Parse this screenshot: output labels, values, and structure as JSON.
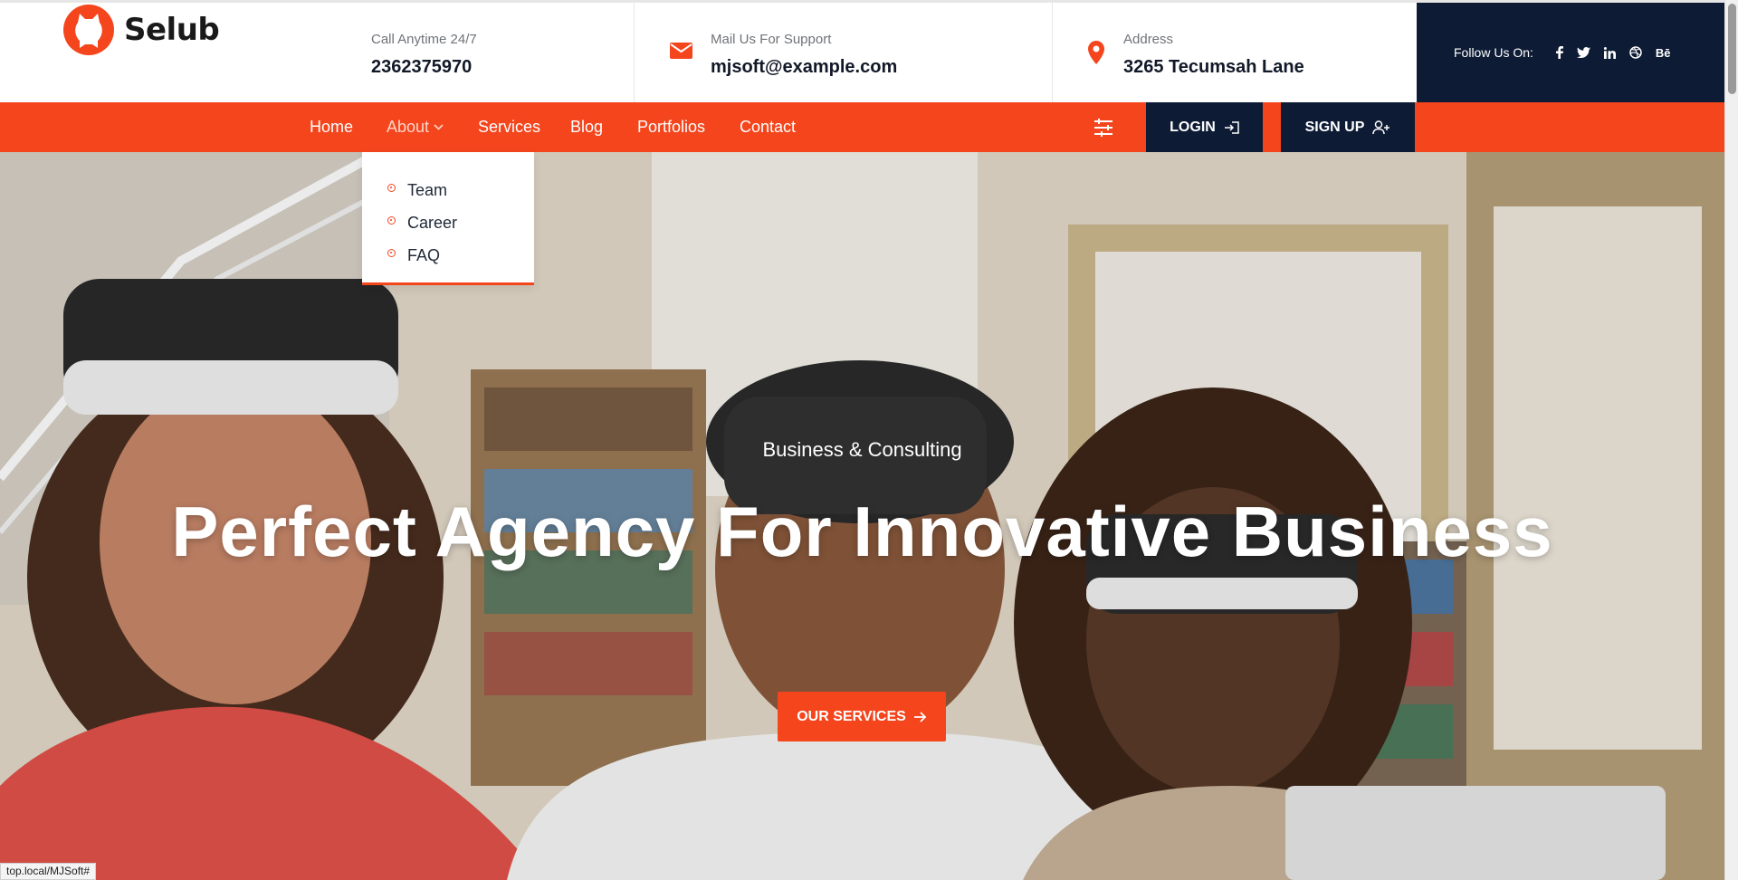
{
  "brand": {
    "name": "Selub",
    "accent": "#f4451d",
    "dark": "#0d1b35"
  },
  "contact": {
    "phone_label": "Call Anytime 24/7",
    "phone_value": "2362375970",
    "mail_label": "Mail Us For Support",
    "mail_value": "mjsoft@example.com",
    "address_label": "Address",
    "address_value": "3265 Tecumsah Lane"
  },
  "social": {
    "label": "Follow Us On:",
    "icons": [
      "facebook-icon",
      "twitter-icon",
      "linkedin-icon",
      "dribbble-icon",
      "behance-icon"
    ],
    "behance_text": "Bē"
  },
  "nav": {
    "items": [
      {
        "label": "Home"
      },
      {
        "label": "About",
        "active": true
      },
      {
        "label": "Services"
      },
      {
        "label": "Blog"
      },
      {
        "label": "Portfolios"
      },
      {
        "label": "Contact"
      }
    ],
    "login_label": "LOGIN",
    "signup_label": "SIGN UP"
  },
  "dropdown": {
    "items": [
      "Team",
      "Career",
      "FAQ"
    ]
  },
  "hero": {
    "subtitle": "Business & Consulting",
    "title": "Perfect Agency For Innovative Business",
    "button_label": "OUR SERVICES"
  },
  "status_url": "top.local/MJSoft#"
}
